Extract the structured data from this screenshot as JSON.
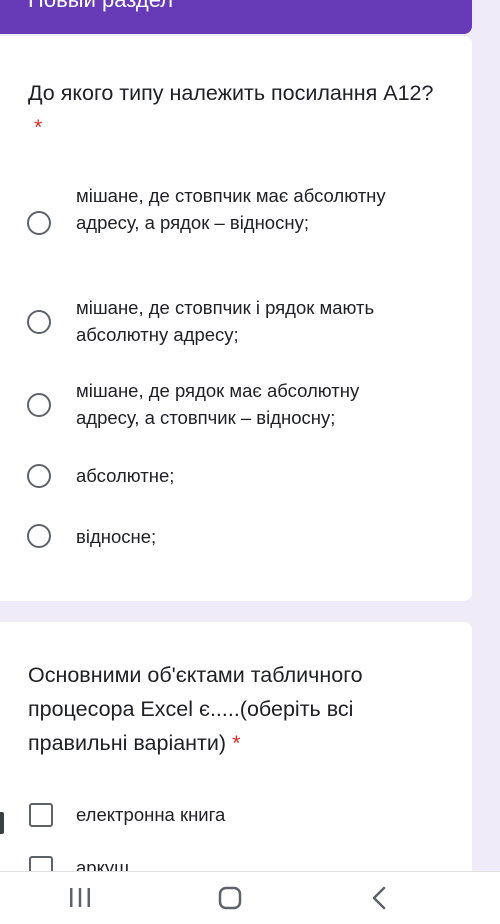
{
  "section": {
    "title": "Новый раздел"
  },
  "question1": {
    "text": "До якого типу належить посилання А12?",
    "required_mark": "*",
    "options": [
      "мішане, де стовпчик має абсолютну адресу, а рядок – відносну;",
      "мішане, де стовпчик і рядок мають абсолютну адресу;",
      "мішане, де рядок має абсолютну адресу, а стовпчик – відносну;",
      "абсолютне;",
      "відносне;"
    ]
  },
  "question2": {
    "text": "Основними об'єктами табличного процесора Excel є.....(оберіть всі правильні варіанти)",
    "required_mark": "*",
    "options": [
      "електронна книга",
      "аркуш"
    ]
  },
  "navbar": {
    "icons": [
      "recent-apps-icon",
      "home-icon",
      "back-icon"
    ]
  },
  "colors": {
    "header": "#673ab7",
    "background": "#f0ebf8",
    "required": "#d93025"
  }
}
